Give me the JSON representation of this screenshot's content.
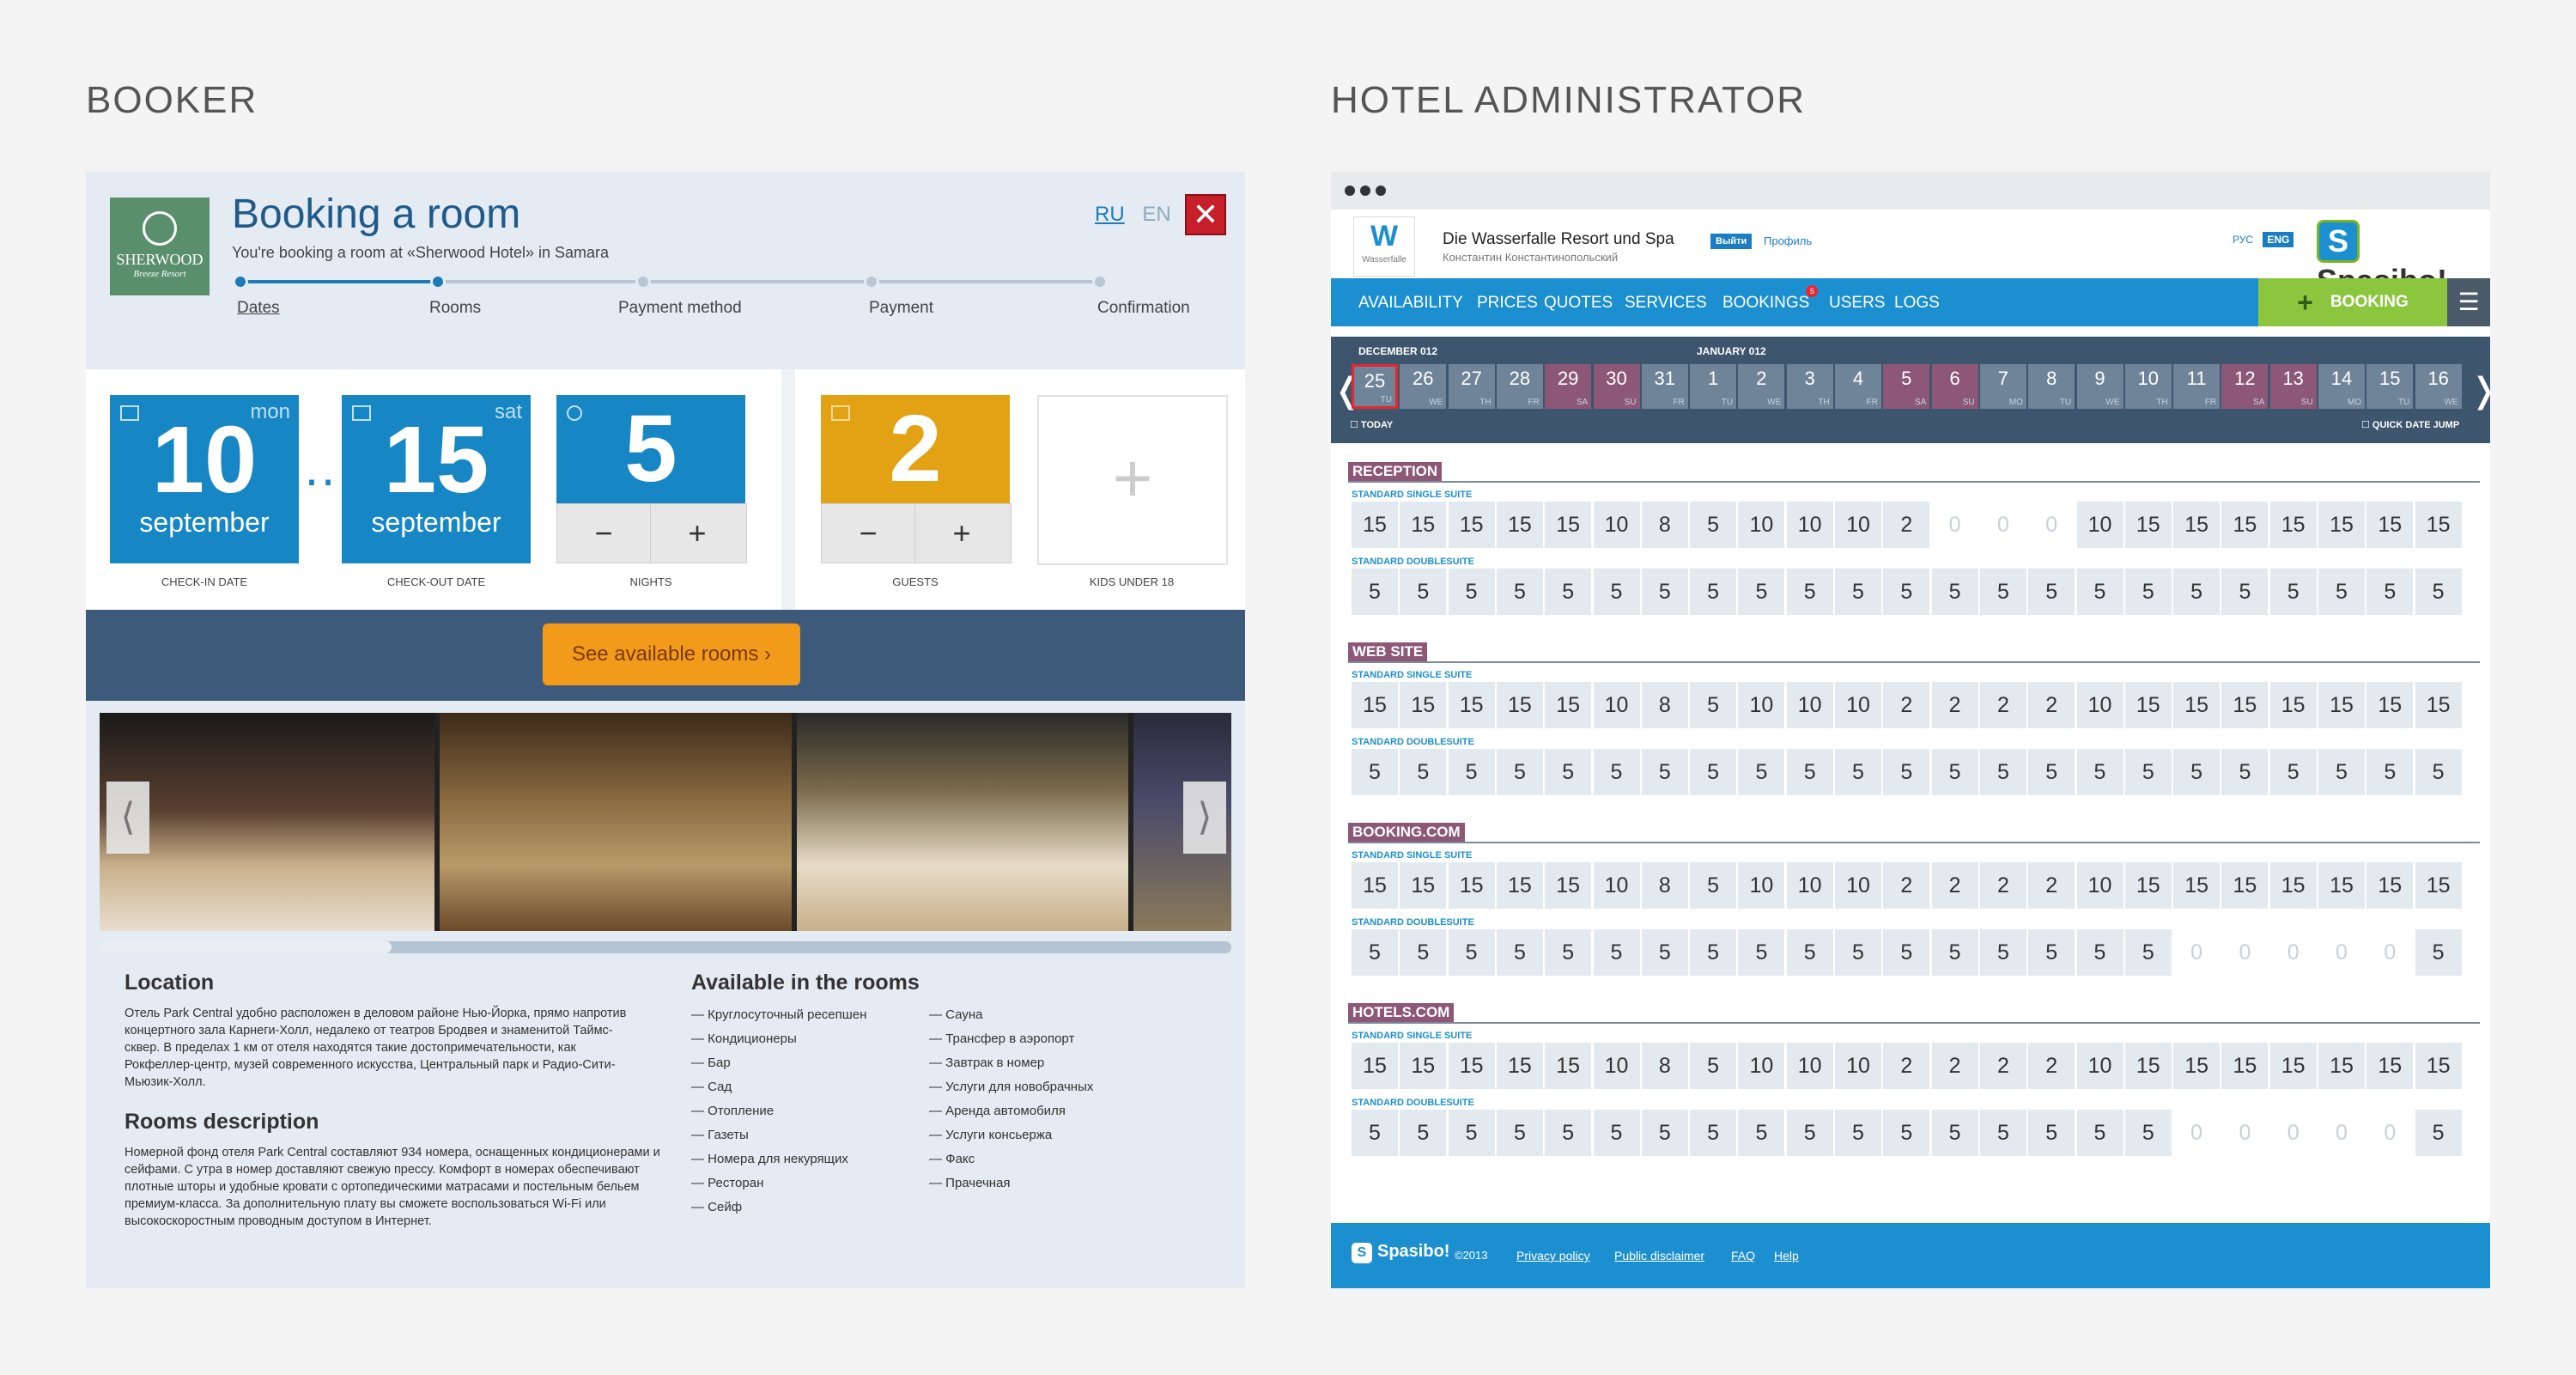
{
  "sections": {
    "booker": "BOOKER",
    "admin": "HOTEL ADMINISTRATOR"
  },
  "booker": {
    "logo": {
      "brand": "SHERWOOD",
      "sub": "Breeze Resort"
    },
    "title": "Booking a room",
    "subtitle": "You're booking a room at «Sherwood Hotel» in Samara",
    "langs": {
      "active": "RU",
      "other": "EN"
    },
    "close": "✕",
    "steps": [
      "Dates",
      "Rooms",
      "Payment method",
      "Payment",
      "Confirmation"
    ],
    "checkin": {
      "day": "10",
      "month": "september",
      "dow": "mon",
      "label": "CHECK-IN DATE"
    },
    "checkout": {
      "day": "15",
      "month": "september",
      "dow": "sat",
      "label": "CHECK-OUT DATE"
    },
    "nights": {
      "value": "5",
      "label": "NIGHTS"
    },
    "guests": {
      "value": "2",
      "label": "GUESTS"
    },
    "kids": {
      "label": "KIDS UNDER 18"
    },
    "minus": "−",
    "plus": "+",
    "ellipsis": "…",
    "cta": "See available rooms  ›",
    "arrows": {
      "left": "⟨",
      "right": "⟩"
    },
    "location": {
      "title": "Location",
      "text": "Отель Park Central удобно расположен в деловом районе Нью-Йорка, прямо напротив концертного зала Карнеги-Холл, недалеко от театров Бродвея и знаменитой Таймс-сквер. В пределах 1 км от отеля находятся такие достопримечательности, как Рокфеллер-центр, музей современного искусства, Центральный парк и Радио-Сити-Мьюзик-Холл."
    },
    "rooms_desc": {
      "title": "Rooms description",
      "text": "Номерной фонд отеля Park Central составляют 934 номера, оснащенных кондиционерами и сейфами. С утра в номер доставляют свежую прессу. Комфорт в номерах обеспечивают плотные шторы и удобные кровати с ортопедическими матрасами и постельным бельем премиум-класса. За дополнительную плату вы сможете воспользоваться Wi-Fi или высокоскоростным проводным доступом в Интернет."
    },
    "amenities": {
      "title": "Available in the rooms",
      "col1": [
        "— Круглосуточный ресепшен",
        "— Кондиционеры",
        "— Бар",
        "— Сад",
        "— Отопление",
        "— Газеты",
        "— Номера для некурящих",
        "— Ресторан",
        "— Сейф"
      ],
      "col2": [
        "— Сауна",
        "— Трансфер в аэропорт",
        "— Завтрак в номер",
        "— Услуги для новобрачных",
        "— Аренда автомобиля",
        "— Услуги консьержа",
        "— Факс",
        "— Прачечная"
      ]
    }
  },
  "admin": {
    "logo_text": "Wasserfalle",
    "hotel": "Die Wasserfalle Resort und Spa",
    "user": "Константин Константинопольский",
    "logout": "Выйти",
    "profile": "Профиль",
    "langs": {
      "ru": "РУС",
      "en": "ENG"
    },
    "brand": "Spasibo!",
    "brand_s": "S",
    "nav": [
      "AVAILABILITY",
      "PRICES",
      "QUOTES",
      "SERVICES",
      "BOOKINGS",
      "USERS",
      "LOGS"
    ],
    "nav_badge": "5",
    "booking_btn": "BOOKING",
    "booking_plus": "+",
    "settings_icon": "☰",
    "calendar": {
      "month1": "DECEMBER 012",
      "month2": "JANUARY 012",
      "prev": "❬",
      "next": "❭",
      "today": "☐ TODAY",
      "jump": "☐ QUICK DATE JUMP",
      "days": [
        {
          "n": "25",
          "w": "TU"
        },
        {
          "n": "26",
          "w": "WE"
        },
        {
          "n": "27",
          "w": "TH"
        },
        {
          "n": "28",
          "w": "FR"
        },
        {
          "n": "29",
          "w": "SA"
        },
        {
          "n": "30",
          "w": "SU"
        },
        {
          "n": "31",
          "w": "FR"
        },
        {
          "n": "1",
          "w": "TU"
        },
        {
          "n": "2",
          "w": "WE"
        },
        {
          "n": "3",
          "w": "TH"
        },
        {
          "n": "4",
          "w": "FR"
        },
        {
          "n": "5",
          "w": "SA"
        },
        {
          "n": "6",
          "w": "SU"
        },
        {
          "n": "7",
          "w": "MO"
        },
        {
          "n": "8",
          "w": "TU"
        },
        {
          "n": "9",
          "w": "WE"
        },
        {
          "n": "10",
          "w": "TH"
        },
        {
          "n": "11",
          "w": "FR"
        },
        {
          "n": "12",
          "w": "SA"
        },
        {
          "n": "13",
          "w": "SU"
        },
        {
          "n": "14",
          "w": "MO"
        },
        {
          "n": "15",
          "w": "TU"
        },
        {
          "n": "16",
          "w": "WE"
        }
      ]
    },
    "channels": [
      {
        "name": "RECEPTION",
        "single_label": "STANDARD SINGLE SUITE",
        "double_label": "STANDARD DOUBLESUITE",
        "single": [
          "15",
          "15",
          "15",
          "15",
          "15",
          "10",
          "8",
          "5",
          "10",
          "10",
          "10",
          "2",
          "0",
          "0",
          "0",
          "10",
          "15",
          "15",
          "15",
          "15",
          "15",
          "15",
          "15"
        ],
        "double": [
          "5",
          "5",
          "5",
          "5",
          "5",
          "5",
          "5",
          "5",
          "5",
          "5",
          "5",
          "5",
          "5",
          "5",
          "5",
          "5",
          "5",
          "5",
          "5",
          "5",
          "5",
          "5",
          "5"
        ]
      },
      {
        "name": "WEB SITE",
        "single_label": "STANDARD SINGLE SUITE",
        "double_label": "STANDARD DOUBLESUITE",
        "single": [
          "15",
          "15",
          "15",
          "15",
          "15",
          "10",
          "8",
          "5",
          "10",
          "10",
          "10",
          "2",
          "2",
          "2",
          "2",
          "10",
          "15",
          "15",
          "15",
          "15",
          "15",
          "15",
          "15"
        ],
        "double": [
          "5",
          "5",
          "5",
          "5",
          "5",
          "5",
          "5",
          "5",
          "5",
          "5",
          "5",
          "5",
          "5",
          "5",
          "5",
          "5",
          "5",
          "5",
          "5",
          "5",
          "5",
          "5",
          "5"
        ]
      },
      {
        "name": "BOOKING.COM",
        "single_label": "STANDARD SINGLE SUITE",
        "double_label": "STANDARD DOUBLESUITE",
        "single": [
          "15",
          "15",
          "15",
          "15",
          "15",
          "10",
          "8",
          "5",
          "10",
          "10",
          "10",
          "2",
          "2",
          "2",
          "2",
          "10",
          "15",
          "15",
          "15",
          "15",
          "15",
          "15",
          "15"
        ],
        "double": [
          "5",
          "5",
          "5",
          "5",
          "5",
          "5",
          "5",
          "5",
          "5",
          "5",
          "5",
          "5",
          "5",
          "5",
          "5",
          "5",
          "5",
          "0",
          "0",
          "0",
          "0",
          "0",
          "5"
        ]
      },
      {
        "name": "HOTELS.COM",
        "single_label": "STANDARD SINGLE SUITE",
        "double_label": "STANDARD DOUBLESUITE",
        "single": [
          "15",
          "15",
          "15",
          "15",
          "15",
          "10",
          "8",
          "5",
          "10",
          "10",
          "10",
          "2",
          "2",
          "2",
          "2",
          "10",
          "15",
          "15",
          "15",
          "15",
          "15",
          "15",
          "15"
        ],
        "double": [
          "5",
          "5",
          "5",
          "5",
          "5",
          "5",
          "5",
          "5",
          "5",
          "5",
          "5",
          "5",
          "5",
          "5",
          "5",
          "5",
          "5",
          "0",
          "0",
          "0",
          "0",
          "0",
          "5"
        ]
      }
    ],
    "footer": {
      "brand": "Spasibo!",
      "brand_s": "S",
      "copy": "©2013",
      "links": [
        "Privacy policy",
        "Public disclaimer",
        "FAQ",
        "Help"
      ]
    }
  },
  "colors": {
    "accent_blue": "#1c8fd0",
    "weekend": "#8d5778",
    "green": "#8cc63f",
    "orange": "#f29a1a",
    "gold": "#e3a114"
  }
}
